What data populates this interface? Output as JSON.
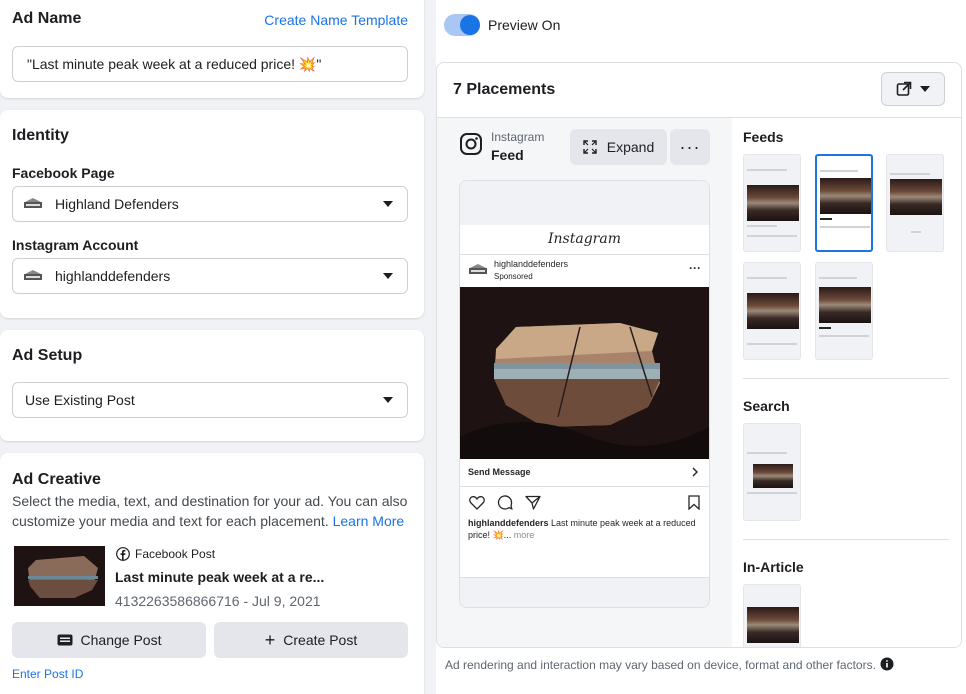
{
  "ad_name": {
    "heading": "Ad Name",
    "template_link": "Create Name Template",
    "value": "\"Last minute peak week at a reduced price! 💥\""
  },
  "identity": {
    "heading": "Identity",
    "facebook_page_label": "Facebook Page",
    "facebook_page_value": "Highland Defenders",
    "instagram_label": "Instagram Account",
    "instagram_value": "highlanddefenders"
  },
  "ad_setup": {
    "heading": "Ad Setup",
    "value": "Use Existing Post"
  },
  "ad_creative": {
    "heading": "Ad Creative",
    "description": "Select the media, text, and destination for your ad. You can also customize your media and text for each placement.",
    "learn_more": "Learn More",
    "post_source": "Facebook Post",
    "post_title": "Last minute peak week at a re...",
    "post_meta": "4132263586866716 - Jul 9, 2021",
    "change_post": "Change Post",
    "create_post": "Create Post",
    "enter_post_id": "Enter Post ID"
  },
  "preview": {
    "toggle_label": "Preview On",
    "placements_title": "7 Placements",
    "platform": "Instagram",
    "placement": "Feed",
    "expand": "Expand",
    "ig_wordmark": "Instagram",
    "account": "highlanddefenders",
    "sponsored": "Sponsored",
    "cta": "Send Message",
    "caption_account": "highlanddefenders",
    "caption_text": "Last minute peak week at a reduced price! 💥...",
    "caption_more": "more",
    "sections": [
      "Feeds",
      "Search",
      "In-Article"
    ],
    "footer_note": "Ad rendering and interaction may vary based on device, format and other factors."
  },
  "colors": {
    "accent": "#1b74e4",
    "background": "#f0f2f5"
  },
  "icons": [
    "caret-down-icon",
    "instagram-icon",
    "expand-icon",
    "more-icon",
    "external-link-icon",
    "heart-icon",
    "comment-icon",
    "share-icon",
    "bookmark-icon",
    "facebook-icon",
    "post-icon",
    "plus-icon",
    "info-icon",
    "chevron-right-icon"
  ]
}
